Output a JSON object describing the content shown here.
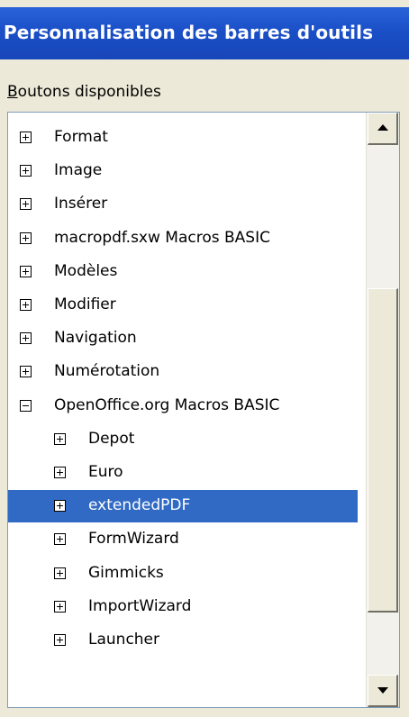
{
  "dialog": {
    "title": "Personnalisation des barres d'outils"
  },
  "section": {
    "label_accel": "B",
    "label_rest": "outons disponibles"
  },
  "tree": {
    "items": [
      {
        "label": "Format",
        "expanded": false,
        "selected": false,
        "level": 0
      },
      {
        "label": "Image",
        "expanded": false,
        "selected": false,
        "level": 0
      },
      {
        "label": "Insérer",
        "expanded": false,
        "selected": false,
        "level": 0
      },
      {
        "label": "macropdf.sxw Macros BASIC",
        "expanded": false,
        "selected": false,
        "level": 0
      },
      {
        "label": "Modèles",
        "expanded": false,
        "selected": false,
        "level": 0
      },
      {
        "label": "Modifier",
        "expanded": false,
        "selected": false,
        "level": 0
      },
      {
        "label": "Navigation",
        "expanded": false,
        "selected": false,
        "level": 0
      },
      {
        "label": "Numérotation",
        "expanded": false,
        "selected": false,
        "level": 0
      },
      {
        "label": "OpenOffice.org Macros BASIC",
        "expanded": true,
        "selected": false,
        "level": 0
      },
      {
        "label": "Depot",
        "expanded": false,
        "selected": false,
        "level": 1
      },
      {
        "label": "Euro",
        "expanded": false,
        "selected": false,
        "level": 1
      },
      {
        "label": "extendedPDF",
        "expanded": false,
        "selected": true,
        "level": 1
      },
      {
        "label": "FormWizard",
        "expanded": false,
        "selected": false,
        "level": 1
      },
      {
        "label": "Gimmicks",
        "expanded": false,
        "selected": false,
        "level": 1
      },
      {
        "label": "ImportWizard",
        "expanded": false,
        "selected": false,
        "level": 1
      },
      {
        "label": "Launcher",
        "expanded": false,
        "selected": false,
        "level": 1
      }
    ]
  },
  "icons": {
    "collapsed": "plus-box-icon",
    "expanded": "minus-box-icon",
    "scroll_up": "scroll-up-arrow-icon",
    "scroll_down": "scroll-down-arrow-icon"
  },
  "colors": {
    "title_bar": "#1a4fc7",
    "selection": "#316ac5",
    "dialog_bg": "#ece9d8",
    "list_bg": "#ffffff"
  }
}
